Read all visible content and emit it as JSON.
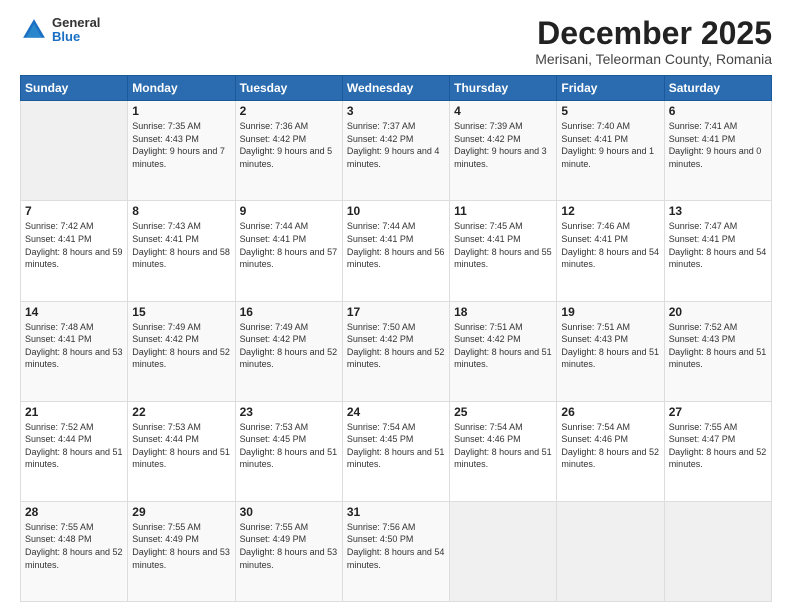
{
  "header": {
    "logo": {
      "general": "General",
      "blue": "Blue"
    },
    "title": "December 2025",
    "location": "Merisani, Teleorman County, Romania"
  },
  "days_of_week": [
    "Sunday",
    "Monday",
    "Tuesday",
    "Wednesday",
    "Thursday",
    "Friday",
    "Saturday"
  ],
  "weeks": [
    [
      {
        "day": "",
        "sunrise": "",
        "sunset": "",
        "daylight": ""
      },
      {
        "day": "1",
        "sunrise": "Sunrise: 7:35 AM",
        "sunset": "Sunset: 4:43 PM",
        "daylight": "Daylight: 9 hours and 7 minutes."
      },
      {
        "day": "2",
        "sunrise": "Sunrise: 7:36 AM",
        "sunset": "Sunset: 4:42 PM",
        "daylight": "Daylight: 9 hours and 5 minutes."
      },
      {
        "day": "3",
        "sunrise": "Sunrise: 7:37 AM",
        "sunset": "Sunset: 4:42 PM",
        "daylight": "Daylight: 9 hours and 4 minutes."
      },
      {
        "day": "4",
        "sunrise": "Sunrise: 7:39 AM",
        "sunset": "Sunset: 4:42 PM",
        "daylight": "Daylight: 9 hours and 3 minutes."
      },
      {
        "day": "5",
        "sunrise": "Sunrise: 7:40 AM",
        "sunset": "Sunset: 4:41 PM",
        "daylight": "Daylight: 9 hours and 1 minute."
      },
      {
        "day": "6",
        "sunrise": "Sunrise: 7:41 AM",
        "sunset": "Sunset: 4:41 PM",
        "daylight": "Daylight: 9 hours and 0 minutes."
      }
    ],
    [
      {
        "day": "7",
        "sunrise": "Sunrise: 7:42 AM",
        "sunset": "Sunset: 4:41 PM",
        "daylight": "Daylight: 8 hours and 59 minutes."
      },
      {
        "day": "8",
        "sunrise": "Sunrise: 7:43 AM",
        "sunset": "Sunset: 4:41 PM",
        "daylight": "Daylight: 8 hours and 58 minutes."
      },
      {
        "day": "9",
        "sunrise": "Sunrise: 7:44 AM",
        "sunset": "Sunset: 4:41 PM",
        "daylight": "Daylight: 8 hours and 57 minutes."
      },
      {
        "day": "10",
        "sunrise": "Sunrise: 7:44 AM",
        "sunset": "Sunset: 4:41 PM",
        "daylight": "Daylight: 8 hours and 56 minutes."
      },
      {
        "day": "11",
        "sunrise": "Sunrise: 7:45 AM",
        "sunset": "Sunset: 4:41 PM",
        "daylight": "Daylight: 8 hours and 55 minutes."
      },
      {
        "day": "12",
        "sunrise": "Sunrise: 7:46 AM",
        "sunset": "Sunset: 4:41 PM",
        "daylight": "Daylight: 8 hours and 54 minutes."
      },
      {
        "day": "13",
        "sunrise": "Sunrise: 7:47 AM",
        "sunset": "Sunset: 4:41 PM",
        "daylight": "Daylight: 8 hours and 54 minutes."
      }
    ],
    [
      {
        "day": "14",
        "sunrise": "Sunrise: 7:48 AM",
        "sunset": "Sunset: 4:41 PM",
        "daylight": "Daylight: 8 hours and 53 minutes."
      },
      {
        "day": "15",
        "sunrise": "Sunrise: 7:49 AM",
        "sunset": "Sunset: 4:42 PM",
        "daylight": "Daylight: 8 hours and 52 minutes."
      },
      {
        "day": "16",
        "sunrise": "Sunrise: 7:49 AM",
        "sunset": "Sunset: 4:42 PM",
        "daylight": "Daylight: 8 hours and 52 minutes."
      },
      {
        "day": "17",
        "sunrise": "Sunrise: 7:50 AM",
        "sunset": "Sunset: 4:42 PM",
        "daylight": "Daylight: 8 hours and 52 minutes."
      },
      {
        "day": "18",
        "sunrise": "Sunrise: 7:51 AM",
        "sunset": "Sunset: 4:42 PM",
        "daylight": "Daylight: 8 hours and 51 minutes."
      },
      {
        "day": "19",
        "sunrise": "Sunrise: 7:51 AM",
        "sunset": "Sunset: 4:43 PM",
        "daylight": "Daylight: 8 hours and 51 minutes."
      },
      {
        "day": "20",
        "sunrise": "Sunrise: 7:52 AM",
        "sunset": "Sunset: 4:43 PM",
        "daylight": "Daylight: 8 hours and 51 minutes."
      }
    ],
    [
      {
        "day": "21",
        "sunrise": "Sunrise: 7:52 AM",
        "sunset": "Sunset: 4:44 PM",
        "daylight": "Daylight: 8 hours and 51 minutes."
      },
      {
        "day": "22",
        "sunrise": "Sunrise: 7:53 AM",
        "sunset": "Sunset: 4:44 PM",
        "daylight": "Daylight: 8 hours and 51 minutes."
      },
      {
        "day": "23",
        "sunrise": "Sunrise: 7:53 AM",
        "sunset": "Sunset: 4:45 PM",
        "daylight": "Daylight: 8 hours and 51 minutes."
      },
      {
        "day": "24",
        "sunrise": "Sunrise: 7:54 AM",
        "sunset": "Sunset: 4:45 PM",
        "daylight": "Daylight: 8 hours and 51 minutes."
      },
      {
        "day": "25",
        "sunrise": "Sunrise: 7:54 AM",
        "sunset": "Sunset: 4:46 PM",
        "daylight": "Daylight: 8 hours and 51 minutes."
      },
      {
        "day": "26",
        "sunrise": "Sunrise: 7:54 AM",
        "sunset": "Sunset: 4:46 PM",
        "daylight": "Daylight: 8 hours and 52 minutes."
      },
      {
        "day": "27",
        "sunrise": "Sunrise: 7:55 AM",
        "sunset": "Sunset: 4:47 PM",
        "daylight": "Daylight: 8 hours and 52 minutes."
      }
    ],
    [
      {
        "day": "28",
        "sunrise": "Sunrise: 7:55 AM",
        "sunset": "Sunset: 4:48 PM",
        "daylight": "Daylight: 8 hours and 52 minutes."
      },
      {
        "day": "29",
        "sunrise": "Sunrise: 7:55 AM",
        "sunset": "Sunset: 4:49 PM",
        "daylight": "Daylight: 8 hours and 53 minutes."
      },
      {
        "day": "30",
        "sunrise": "Sunrise: 7:55 AM",
        "sunset": "Sunset: 4:49 PM",
        "daylight": "Daylight: 8 hours and 53 minutes."
      },
      {
        "day": "31",
        "sunrise": "Sunrise: 7:56 AM",
        "sunset": "Sunset: 4:50 PM",
        "daylight": "Daylight: 8 hours and 54 minutes."
      },
      {
        "day": "",
        "sunrise": "",
        "sunset": "",
        "daylight": ""
      },
      {
        "day": "",
        "sunrise": "",
        "sunset": "",
        "daylight": ""
      },
      {
        "day": "",
        "sunrise": "",
        "sunset": "",
        "daylight": ""
      }
    ]
  ]
}
